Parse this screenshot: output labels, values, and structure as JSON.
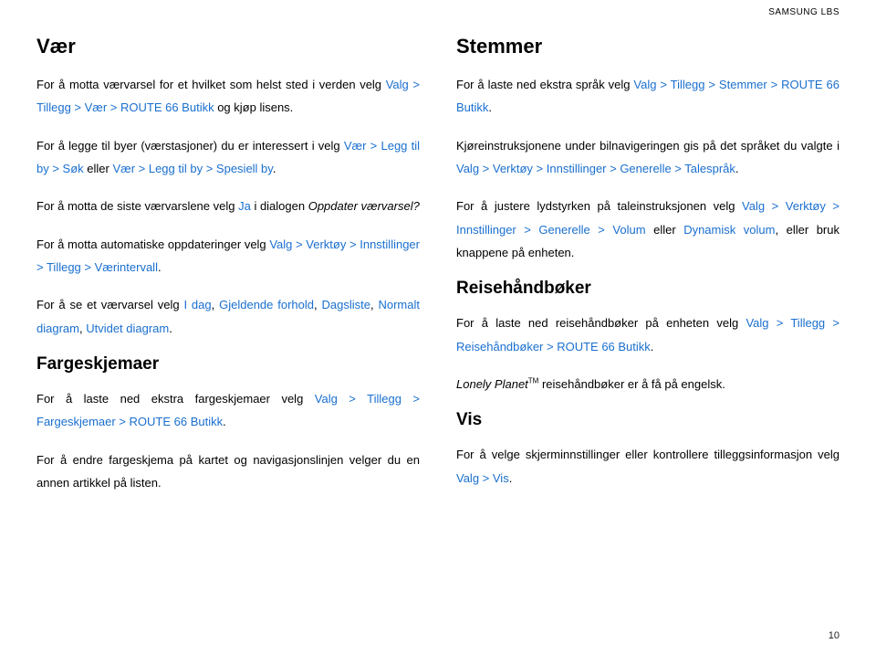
{
  "brand": "SAMSUNG LBS",
  "page_number": "10",
  "left": {
    "h_vaer": "Vær",
    "p1_a": "For å motta værvarsel for et hvilket som helst sted i verden velg ",
    "p1_b": "Valg > Tillegg > Vær > ROUTE 66 Butikk",
    "p1_c": " og kjøp lisens.",
    "p2_a": "For å legge til byer (værstasjoner) du er interessert i velg ",
    "p2_b": "Vær > Legg til by > Søk",
    "p2_c": " eller ",
    "p2_d": "Vær > Legg til by > Spesiell by",
    "p2_e": ".",
    "p3_a": "For å motta de siste værvarslene velg ",
    "p3_b": "Ja",
    "p3_c": " i dialogen ",
    "p3_d": "Oppdater værvarsel?",
    "p4_a": "For å motta automatiske oppdateringer velg ",
    "p4_b": "Valg > Verktøy > Innstillinger > Tillegg > Værintervall",
    "p4_c": ".",
    "p5_a": "For å se et værvarsel velg ",
    "p5_b": "I dag",
    "p5_c": ", ",
    "p5_d": "Gjeldende forhold",
    "p5_e": ", ",
    "p5_f": "Dagsliste",
    "p5_g": ", ",
    "p5_h": "Normalt diagram",
    "p5_i": ", ",
    "p5_j": "Utvidet diagram",
    "p5_k": ".",
    "h_farg": "Fargeskjemaer",
    "p6_a": "For å laste ned ekstra fargeskjemaer velg ",
    "p6_b": "Valg > Tillegg > Fargeskjemaer > ROUTE 66 Butikk",
    "p6_c": ".",
    "p7": "For å endre fargeskjema på kartet og navigasjonslinjen velger du en annen artikkel på listen."
  },
  "right": {
    "h_stem": "Stemmer",
    "p1_a": "For å laste ned ekstra språk velg ",
    "p1_b": "Valg > Tillegg > Stemmer > ROUTE 66 Butikk",
    "p1_c": ".",
    "p2_a": "Kjøreinstruksjonene under bilnavigeringen gis på det språket du valgte i ",
    "p2_b": "Valg > Verktøy > Innstillinger > Generelle > Talespråk",
    "p2_c": ".",
    "p3_a": "For å justere lydstyrken på taleinstruksjonen velg ",
    "p3_b": "Valg > Verktøy > Innstillinger > Generelle > Volum",
    "p3_c": " eller ",
    "p3_d": "Dynamisk volum",
    "p3_e": ", eller bruk knappene på enheten.",
    "h_reise": "Reisehåndbøker",
    "p4_a": "For å laste ned reisehåndbøker på enheten velg ",
    "p4_b": "Valg > Tillegg > Reisehåndbøker > ROUTE 66 Butikk",
    "p4_c": ".",
    "p5_a": "Lonely Planet",
    "p5_b": "TM",
    "p5_c": " reisehåndbøker er å få på engelsk.",
    "h_vis": "Vis",
    "p6_a": "For å velge skjerminnstillinger eller kontrollere tilleggsinformasjon velg ",
    "p6_b": "Valg > Vis",
    "p6_c": "."
  }
}
